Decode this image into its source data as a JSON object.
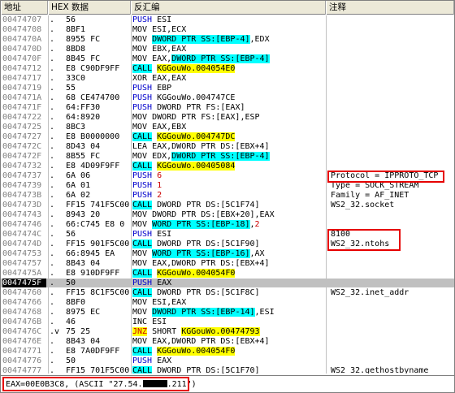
{
  "header": {
    "address": "地址",
    "hex": "HEX 数据",
    "disasm": "反汇编",
    "comment": "注释"
  },
  "rows": [
    {
      "addr": "00474707",
      "mark": ".",
      "hex": "56",
      "asm": "PUSH ESI",
      "cmt": ""
    },
    {
      "addr": "00474708",
      "mark": ".",
      "hex": "8BF1",
      "asm": "MOV ESI,ECX",
      "cmt": ""
    },
    {
      "addr": "0047470A",
      "mark": ".",
      "hex": "8955 FC",
      "asm": "MOV DWORD PTR SS:[EBP-4],EDX",
      "cmt": ""
    },
    {
      "addr": "0047470D",
      "mark": ".",
      "hex": "8BD8",
      "asm": "MOV EBX,EAX",
      "cmt": ""
    },
    {
      "addr": "0047470F",
      "mark": ".",
      "hex": "8B45 FC",
      "asm": "MOV EAX,DWORD PTR SS:[EBP-4]",
      "cmt": ""
    },
    {
      "addr": "00474712",
      "mark": ".",
      "hex": "E8 C90DF9FF",
      "asm": "CALL KGGouWo.004054E0",
      "cmt": ""
    },
    {
      "addr": "00474717",
      "mark": ".",
      "hex": "33C0",
      "asm": "XOR EAX,EAX",
      "cmt": ""
    },
    {
      "addr": "00474719",
      "mark": ".",
      "hex": "55",
      "asm": "PUSH EBP",
      "cmt": ""
    },
    {
      "addr": "0047471A",
      "mark": ".",
      "hex": "68 CE474700",
      "asm": "PUSH KGGouWo.004747CE",
      "cmt": ""
    },
    {
      "addr": "0047471F",
      "mark": ".",
      "hex": "64:FF30",
      "asm": "PUSH DWORD PTR FS:[EAX]",
      "cmt": ""
    },
    {
      "addr": "00474722",
      "mark": ".",
      "hex": "64:8920",
      "asm": "MOV DWORD PTR FS:[EAX],ESP",
      "cmt": ""
    },
    {
      "addr": "00474725",
      "mark": ".",
      "hex": "8BC3",
      "asm": "MOV EAX,EBX",
      "cmt": ""
    },
    {
      "addr": "00474727",
      "mark": ".",
      "hex": "E8 B0000000",
      "asm": "CALL KGGouWo.004747DC",
      "cmt": ""
    },
    {
      "addr": "0047472C",
      "mark": ".",
      "hex": "8D43 04",
      "asm": "LEA EAX,DWORD PTR DS:[EBX+4]",
      "cmt": ""
    },
    {
      "addr": "0047472F",
      "mark": ".",
      "hex": "8B55 FC",
      "asm": "MOV EDX,DWORD PTR SS:[EBP-4]",
      "cmt": ""
    },
    {
      "addr": "00474732",
      "mark": ".",
      "hex": "E8 4D09F9FF",
      "asm": "CALL KGGouWo.00405084",
      "cmt": ""
    },
    {
      "addr": "00474737",
      "mark": ".",
      "hex": "6A 06",
      "asm": "PUSH 6",
      "cmt": "Protocol = IPPROTO_TCP"
    },
    {
      "addr": "00474739",
      "mark": ".",
      "hex": "6A 01",
      "asm": "PUSH 1",
      "cmt": "Type = SOCK_STREAM"
    },
    {
      "addr": "0047473B",
      "mark": ".",
      "hex": "6A 02",
      "asm": "PUSH 2",
      "cmt": "Family = AF_INET"
    },
    {
      "addr": "0047473D",
      "mark": ".",
      "hex": "FF15 741F5C00",
      "asm": "CALL DWORD PTR DS:[5C1F74]",
      "cmt": "WS2_32.socket"
    },
    {
      "addr": "00474743",
      "mark": ".",
      "hex": "8943 20",
      "asm": "MOV DWORD PTR DS:[EBX+20],EAX",
      "cmt": ""
    },
    {
      "addr": "00474746",
      "mark": ".",
      "hex": "66:C745 E8 0",
      "asm": "MOV WORD PTR SS:[EBP-18],2",
      "cmt": ""
    },
    {
      "addr": "0047474C",
      "mark": ".",
      "hex": "56",
      "asm": "PUSH ESI",
      "cmt": "8100"
    },
    {
      "addr": "0047474D",
      "mark": ".",
      "hex": "FF15 901F5C00",
      "asm": "CALL DWORD PTR DS:[5C1F90]",
      "cmt": "WS2_32.ntohs"
    },
    {
      "addr": "00474753",
      "mark": ".",
      "hex": "66:8945 EA",
      "asm": "MOV WORD PTR SS:[EBP-16],AX",
      "cmt": ""
    },
    {
      "addr": "00474757",
      "mark": ".",
      "hex": "8B43 04",
      "asm": "MOV EAX,DWORD PTR DS:[EBX+4]",
      "cmt": ""
    },
    {
      "addr": "0047475A",
      "mark": ".",
      "hex": "E8 910DF9FF",
      "asm": "CALL KGGouWo.004054F0",
      "cmt": ""
    },
    {
      "addr": "0047475F",
      "mark": ".",
      "hex": "50",
      "asm": "PUSH EAX",
      "cmt": ""
    },
    {
      "addr": "00474760",
      "mark": ".",
      "hex": "FF15 8C1F5C00",
      "asm": "CALL DWORD PTR DS:[5C1F8C]",
      "cmt": "WS2_32.inet_addr"
    },
    {
      "addr": "00474766",
      "mark": ".",
      "hex": "8BF0",
      "asm": "MOV ESI,EAX",
      "cmt": ""
    },
    {
      "addr": "00474768",
      "mark": ".",
      "hex": "8975 EC",
      "asm": "MOV DWORD PTR SS:[EBP-14],ESI",
      "cmt": ""
    },
    {
      "addr": "0047476B",
      "mark": ".",
      "hex": "46",
      "asm": "INC ESI",
      "cmt": ""
    },
    {
      "addr": "0047476C",
      "mark": ".v",
      "hex": "75 25",
      "asm": "JNZ SHORT KGGouWo.00474793",
      "cmt": ""
    },
    {
      "addr": "0047476E",
      "mark": ".",
      "hex": "8B43 04",
      "asm": "MOV EAX,DWORD PTR DS:[EBX+4]",
      "cmt": ""
    },
    {
      "addr": "00474771",
      "mark": ".",
      "hex": "E8 7A0DF9FF",
      "asm": "CALL KGGouWo.004054F0",
      "cmt": ""
    },
    {
      "addr": "00474776",
      "mark": ".",
      "hex": "50",
      "asm": "PUSH EAX",
      "cmt": ""
    },
    {
      "addr": "00474777",
      "mark": ".",
      "hex": "FF15 701F5C00",
      "asm": "CALL DWORD PTR DS:[5C1F70]",
      "cmt": "WS2_32.gethostbyname"
    }
  ],
  "status": {
    "prefix": "EAX=00E0B3C8, (ASCII \"27.54.",
    "suffix": ".211\")"
  },
  "colors": {
    "call_highlight": "#00ffff",
    "operand_highlight": "#ffff00",
    "annotation_box": "#e60000"
  }
}
